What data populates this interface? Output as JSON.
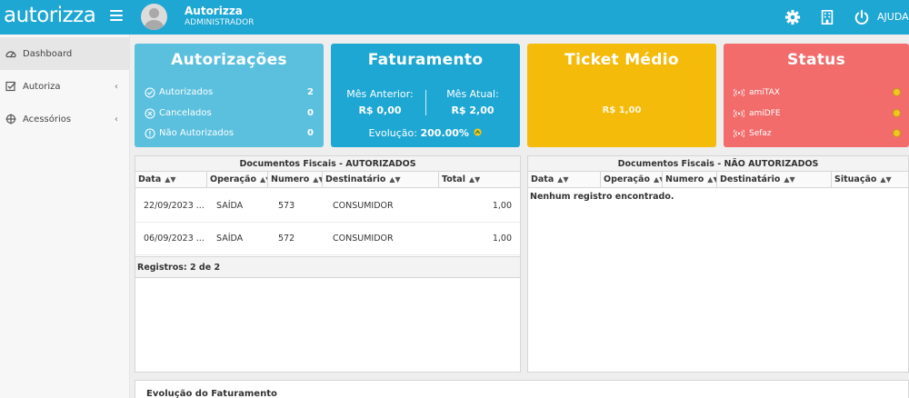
{
  "app": {
    "logo": "autorizza"
  },
  "user": {
    "name": "Autorizza",
    "role": "ADMINISTRADOR"
  },
  "topbar": {
    "help_label": "AJUDA"
  },
  "sidebar": {
    "items": [
      {
        "label": "Dashboard",
        "icon": "dashboard-icon",
        "active": true
      },
      {
        "label": "Autoriza",
        "icon": "check-square-icon",
        "chevron": "‹"
      },
      {
        "label": "Acessórios",
        "icon": "crosshair-icon",
        "chevron": "‹"
      }
    ]
  },
  "cards": {
    "autorizacoes": {
      "title": "Autorizações",
      "rows": [
        {
          "label": "Autorizados",
          "value": "2",
          "icon": "check-circle-icon"
        },
        {
          "label": "Cancelados",
          "value": "0",
          "icon": "x-circle-icon"
        },
        {
          "label": "Não Autorizados",
          "value": "0",
          "icon": "exclamation-circle-icon"
        }
      ],
      "color": "#5bc0de"
    },
    "faturamento": {
      "title": "Faturamento",
      "prev_label": "Mês Anterior:",
      "prev_value": "R$ 0,00",
      "curr_label": "Mês Atual:",
      "curr_value": "R$ 2,00",
      "evolution_label": "Evolução:",
      "evolution_value": "200.00%",
      "color": "#1fa7d3"
    },
    "ticket": {
      "title": "Ticket Médio",
      "value": "R$ 1,00",
      "color": "#f4bb0b"
    },
    "status": {
      "title": "Status",
      "rows": [
        {
          "label": "amiTAX",
          "icon": "wifi-signal-icon"
        },
        {
          "label": "amiDFE",
          "icon": "wifi-signal-icon"
        },
        {
          "label": "Sefaz",
          "icon": "wifi-signal-icon"
        }
      ],
      "color": "#f26c6c"
    }
  },
  "table_autorizados": {
    "title": "Documentos Fiscais - AUTORIZADOS",
    "columns": [
      "Data",
      "Operação",
      "Numero",
      "Destinatário",
      "Total"
    ],
    "rows": [
      {
        "data": "22/09/2023 ...",
        "operacao": "SAÍDA",
        "numero": "573",
        "destinatario": "CONSUMIDOR",
        "total": "1,00"
      },
      {
        "data": "06/09/2023 ...",
        "operacao": "SAÍDA",
        "numero": "572",
        "destinatario": "CONSUMIDOR",
        "total": "1,00"
      }
    ],
    "footer": "Registros: 2 de 2"
  },
  "table_nao_autorizados": {
    "title": "Documentos Fiscais - NÃO AUTORIZADOS",
    "columns": [
      "Data",
      "Operação",
      "Numero",
      "Destinatário",
      "Situação"
    ],
    "empty_message": "Nenhum registro encontrado."
  },
  "chart_section": {
    "title": "Evolução do Faturamento"
  }
}
